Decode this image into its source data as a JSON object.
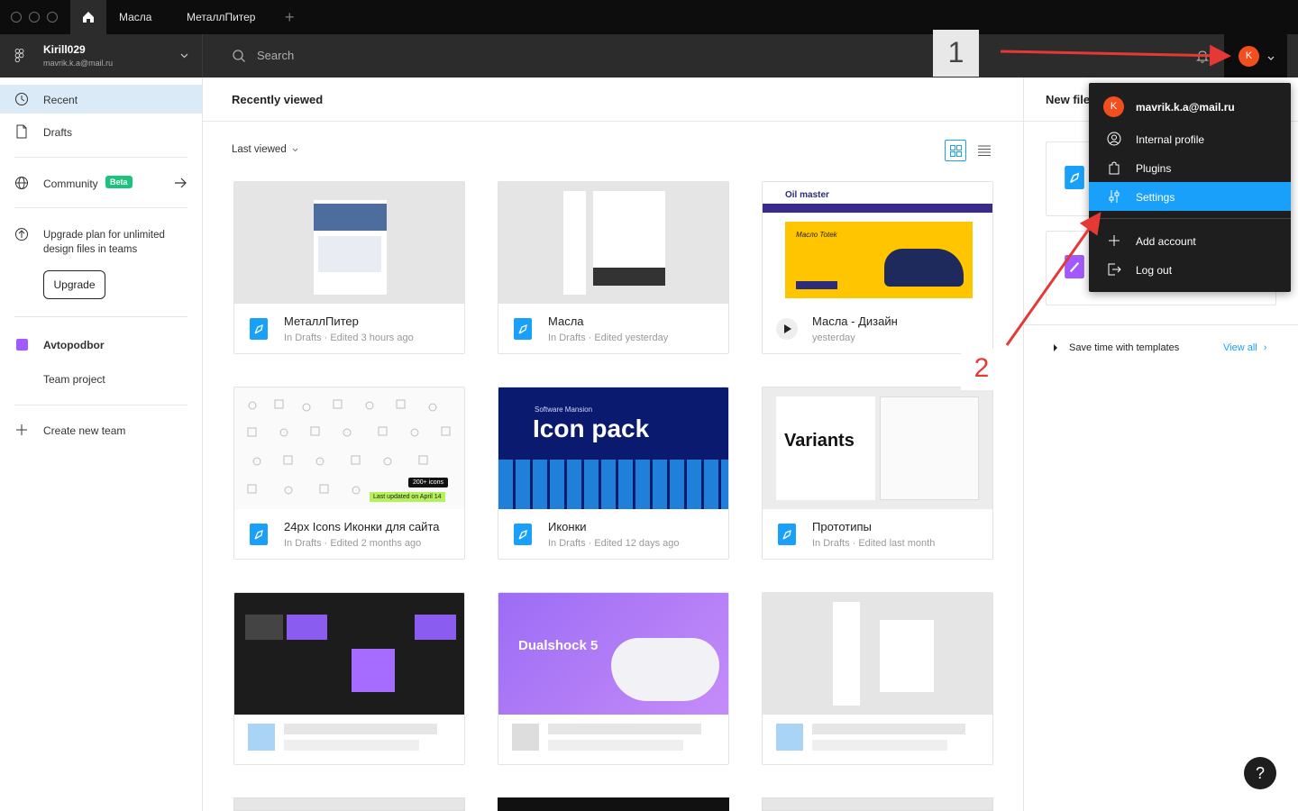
{
  "tabs": [
    {
      "label": "Масла"
    },
    {
      "label": "МеталлПитер"
    }
  ],
  "account": {
    "name": "Kirill029",
    "email": "mavrik.k.a@mail.ru",
    "avatar_initial": "K"
  },
  "search": {
    "placeholder": "Search"
  },
  "sidebar": {
    "recent": "Recent",
    "drafts": "Drafts",
    "community": "Community",
    "community_badge": "Beta",
    "upgrade_text_1": "Upgrade plan for unlimited",
    "upgrade_text_2": "design files in teams",
    "upgrade_button": "Upgrade",
    "team_name": "Avtopodbor",
    "team_project": "Team project",
    "create_team": "Create new team"
  },
  "main": {
    "title": "Recently viewed",
    "sort": "Last viewed",
    "files": [
      {
        "name": "МеталлПитер",
        "meta": "In Drafts · Edited 3 hours ago"
      },
      {
        "name": "Масла",
        "meta": "In Drafts · Edited yesterday"
      },
      {
        "name": "Масла - Дизайн",
        "meta": "yesterday"
      },
      {
        "name": "24px Icons Иконки для сайта",
        "meta": "In Drafts · Edited 2 months ago"
      },
      {
        "name": "Иконки",
        "meta": "In Drafts · Edited 12 days ago"
      },
      {
        "name": "Прототипы",
        "meta": "In Drafts · Edited last month"
      }
    ],
    "thumb_texts": {
      "oil_logo": "Oil master",
      "oil_banner": "Масло Totek",
      "icons_badge": "200+ icons",
      "icons_updated": "Last updated on April 14",
      "iconpack_sub": "Software Mansion",
      "iconpack_title": "Icon pack",
      "variants_title": "Variants",
      "dualshock_title": "Dualshock 5"
    }
  },
  "right_panel": {
    "title": "New file",
    "templates": "Save time with templates",
    "view_all": "View all"
  },
  "menu": {
    "email": "mavrik.k.a@mail.ru",
    "internal_profile": "Internal profile",
    "plugins": "Plugins",
    "settings": "Settings",
    "add_account": "Add account",
    "log_out": "Log out"
  },
  "annotations": {
    "step1": "1",
    "step2": "2"
  },
  "help": "?",
  "colors": {
    "accent": "#18a0fb",
    "avatar": "#f24e1e",
    "team": "#a259ff",
    "arrow": "#e53935"
  }
}
